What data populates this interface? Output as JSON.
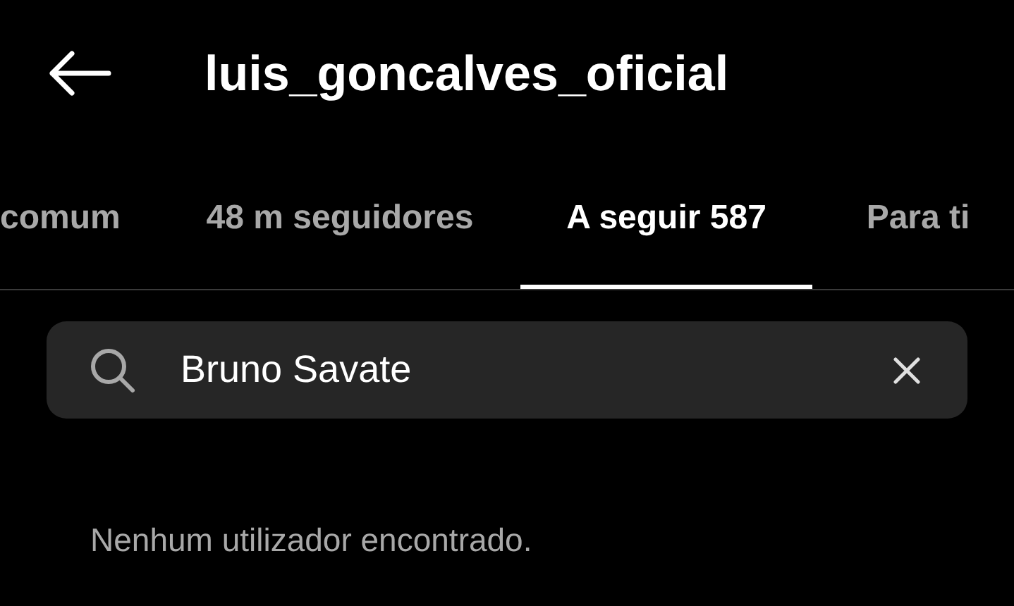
{
  "header": {
    "title": "luis_goncalves_oficial"
  },
  "tabs": [
    {
      "label": "comum",
      "selected": false
    },
    {
      "label": "48 m seguidores",
      "selected": false
    },
    {
      "label": "A seguir 587",
      "selected": true
    },
    {
      "label": "Para ti",
      "selected": false
    }
  ],
  "search": {
    "value": "Bruno Savate"
  },
  "message": "Nenhum utilizador encontrado."
}
